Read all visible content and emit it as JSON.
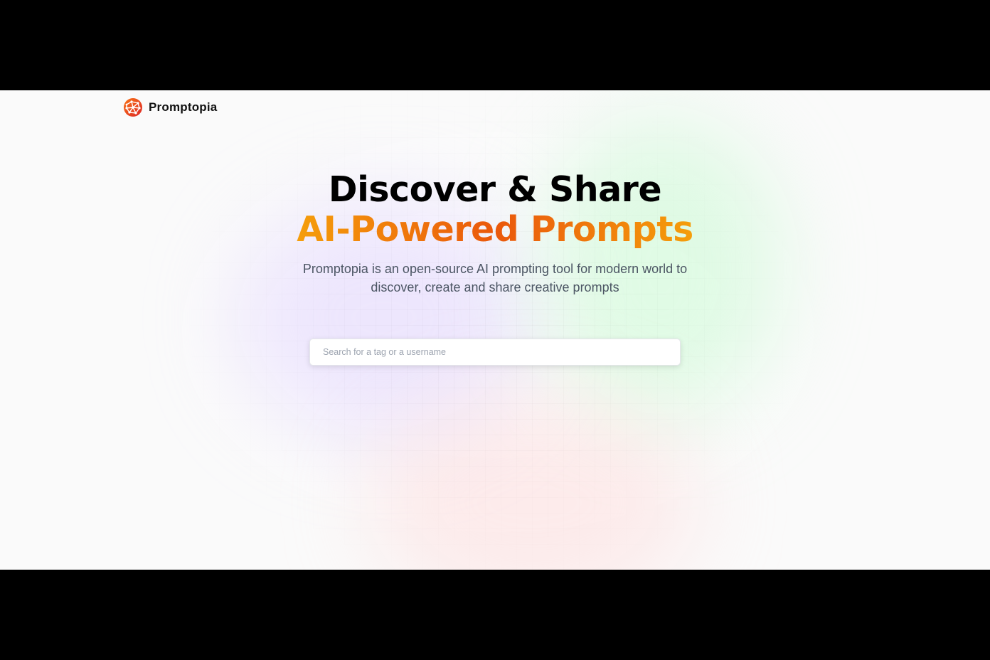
{
  "nav": {
    "brand": "Promptopia",
    "logo_icon": "globe-network-icon"
  },
  "hero": {
    "title_line1": "Discover & Share",
    "title_line2": "AI-Powered Prompts",
    "description": "Promptopia is an open-source AI prompting tool for modern world to discover, create and share creative prompts"
  },
  "search": {
    "placeholder": "Search for a tag or a username",
    "value": ""
  },
  "colors": {
    "accent_orange": "#ea580c",
    "accent_amber": "#f59e0b",
    "text_dark": "#000000",
    "text_muted": "#4b5563",
    "page_bg": "#fafafa"
  }
}
